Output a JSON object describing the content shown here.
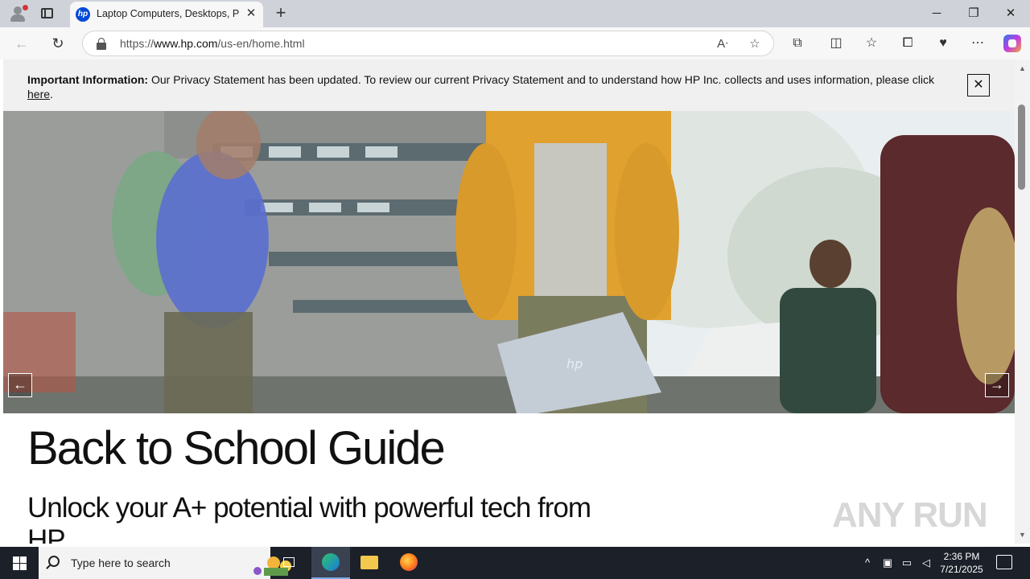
{
  "browser": {
    "tab": {
      "title": "Laptop Computers, Desktops, Printers, Ink & Toner | HP® Official Site",
      "favicon": "hp-logo-icon",
      "favicon_text": "hp"
    },
    "url_prefix": "https://",
    "url_domain": "www.hp.com",
    "url_path": "/us-en/home.html",
    "window_controls": {
      "minimize": "─",
      "restore": "❐",
      "close": "✕"
    },
    "accent_color": "#024ad8"
  },
  "page": {
    "notice": {
      "label": "Important Information:",
      "text": " Our Privacy Statement has been updated. To review our current Privacy Statement and to understand how HP Inc. collects and uses information, please click ",
      "link": "here",
      "after": "."
    },
    "hero": {
      "image": "students-walking-campus-photo",
      "prev": "←",
      "next": "→"
    },
    "headline": "Back to School Guide",
    "subhead": "Unlock your A+ potential with powerful tech from HP"
  },
  "watermark": "ANY RUN",
  "taskbar": {
    "search_placeholder": "Type here to search",
    "time": "2:36 PM",
    "date": "7/21/2025"
  }
}
